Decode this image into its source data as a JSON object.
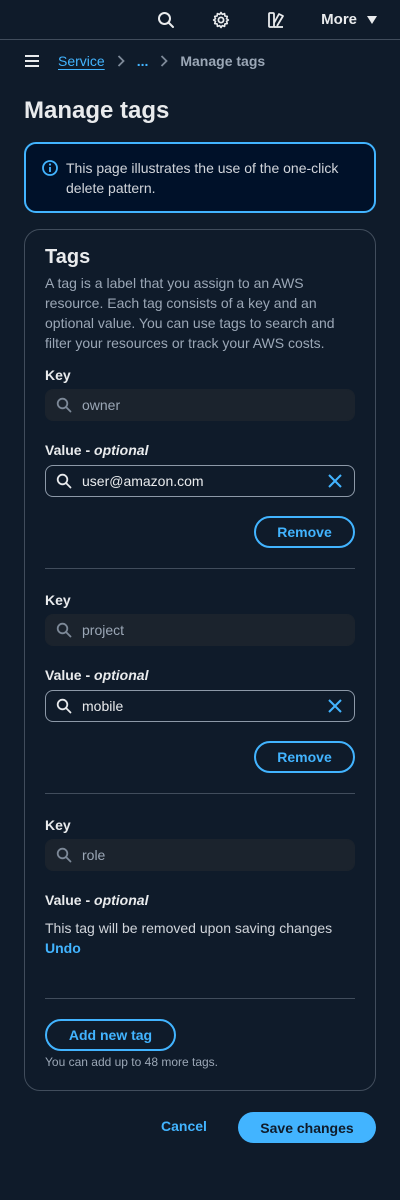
{
  "topbar": {
    "icons": [
      "search-icon",
      "settings-icon",
      "density-icon"
    ],
    "more_label": "More"
  },
  "breadcrumbs": {
    "items": [
      "Service",
      "...",
      "Manage tags"
    ]
  },
  "page": {
    "title": "Manage tags"
  },
  "alert": {
    "text": "This page illustrates the use of the one-click delete pattern."
  },
  "tags_panel": {
    "title": "Tags",
    "description": "A tag is a label that you assign to an AWS resource. Each tag consists of a key and an optional value. You can use tags to search and filter your resources or track your AWS costs.",
    "key_label": "Key",
    "value_label_main": "Value - ",
    "value_label_optional": "optional",
    "remove_label": "Remove",
    "tags": [
      {
        "key": "owner",
        "value": "user@amazon.com",
        "removed": false
      },
      {
        "key": "project",
        "value": "mobile",
        "removed": false
      },
      {
        "key": "role",
        "value": "",
        "removed": true
      }
    ],
    "removed_message": "This tag will be removed upon saving changes",
    "undo_label": "Undo",
    "add_button_label": "Add new tag",
    "add_hint": "You can add up to 48 more tags."
  },
  "footer": {
    "cancel_label": "Cancel",
    "save_label": "Save changes"
  },
  "colors": {
    "background": "#0f1b2a",
    "accent": "#42b4ff",
    "border": "#414d5c",
    "alert_bg": "#001129"
  }
}
